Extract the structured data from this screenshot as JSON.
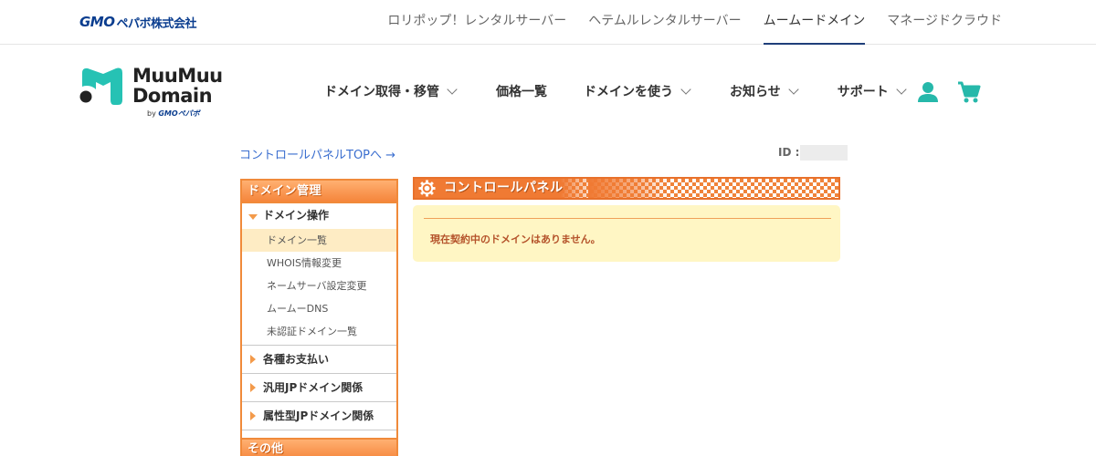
{
  "topbar": {
    "logo_gmo": "GMO",
    "logo_company": "ペパボ株式会社",
    "sites": [
      {
        "label": "ロリポップ！レンタルサーバー",
        "active": false
      },
      {
        "label": "ヘテムルレンタルサーバー",
        "active": false
      },
      {
        "label": "ムームードメイン",
        "active": true
      },
      {
        "label": "マネージドクラウド",
        "active": false
      }
    ]
  },
  "header": {
    "logo_line1": "MuuMuu",
    "logo_line2": "Domain",
    "logo_by": "by",
    "logo_by_brand": "GMOペパボ",
    "logo_color": "#26c2b4",
    "nav": [
      {
        "label": "ドメイン取得・移管",
        "has_dropdown": true
      },
      {
        "label": "価格一覧",
        "has_dropdown": false
      },
      {
        "label": "ドメインを使う",
        "has_dropdown": true
      },
      {
        "label": "お知らせ",
        "has_dropdown": true
      },
      {
        "label": "サポート",
        "has_dropdown": true
      }
    ],
    "icons": [
      "user-icon",
      "cart-icon"
    ],
    "icon_color": "#26b8aa"
  },
  "content": {
    "cp_top_link": "コントロールパネルTOPへ →",
    "id_label": "ID :"
  },
  "sidebar": {
    "heading": "ドメイン管理",
    "open_section": "ドメイン操作",
    "sub_items": [
      {
        "label": "ドメイン一覧",
        "selected": true
      },
      {
        "label": "WHOIS情報変更",
        "selected": false
      },
      {
        "label": "ネームサーバ設定変更",
        "selected": false
      },
      {
        "label": "ムームーDNS",
        "selected": false
      },
      {
        "label": "未認証ドメイン一覧",
        "selected": false
      }
    ],
    "sections": [
      "各種お支払い",
      "汎用JPドメイン関係",
      "属性型JPドメイン関係"
    ],
    "heading2": "その他",
    "accent_color": "#f08a3a"
  },
  "panel": {
    "title": "コントロールパネル",
    "message": "現在契約中のドメインはありません。",
    "message_color": "#b4522a",
    "notice_bg": "#fff6c4"
  }
}
